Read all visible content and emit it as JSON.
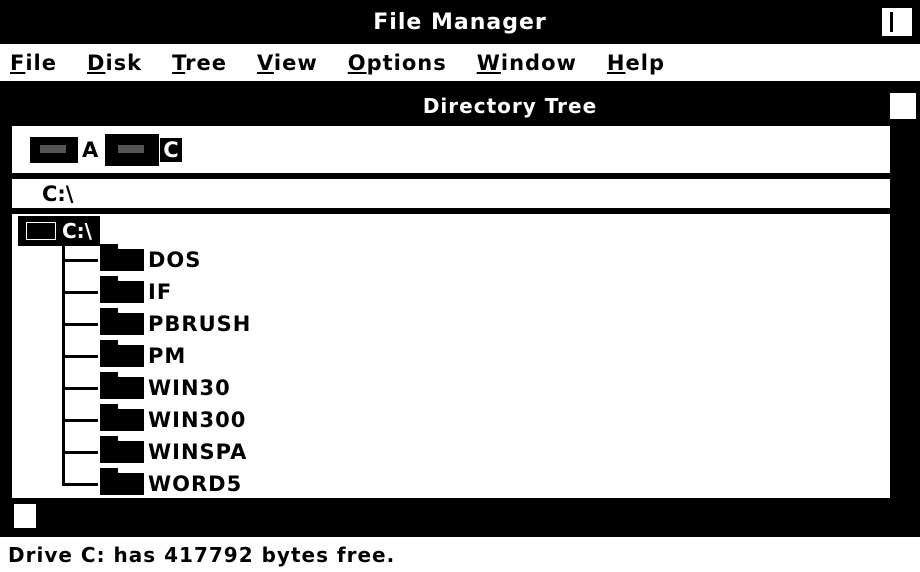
{
  "window": {
    "title": "File Manager"
  },
  "menu": [
    {
      "label": "File",
      "key": "F",
      "rest": "ile"
    },
    {
      "label": "Disk",
      "key": "D",
      "rest": "isk"
    },
    {
      "label": "Tree",
      "key": "T",
      "rest": "ree"
    },
    {
      "label": "View",
      "key": "V",
      "rest": "iew"
    },
    {
      "label": "Options",
      "key": "O",
      "rest": "ptions"
    },
    {
      "label": "Window",
      "key": "W",
      "rest": "indow"
    },
    {
      "label": "Help",
      "key": "H",
      "rest": "elp"
    }
  ],
  "child_window": {
    "title": "Directory Tree"
  },
  "drives": [
    {
      "letter": "A",
      "selected": false,
      "icon": "floppy-drive-icon"
    },
    {
      "letter": "C",
      "selected": true,
      "icon": "hard-drive-icon"
    }
  ],
  "path": "C:\\",
  "tree": {
    "root": "C:\\",
    "folders": [
      "DOS",
      "IF",
      "PBRUSH",
      "PM",
      "WIN30",
      "WIN300",
      "WINSPA",
      "WORD5"
    ]
  },
  "status": "Drive C: has 417792 bytes free."
}
